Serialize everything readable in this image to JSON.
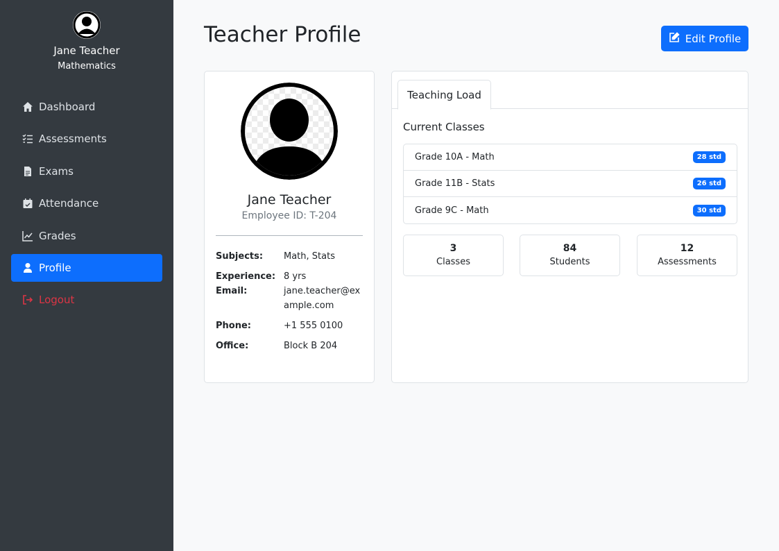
{
  "sidebar": {
    "user_name": "Jane Teacher",
    "department": "Mathematics",
    "nav": [
      {
        "label": "Dashboard",
        "icon": "home-icon"
      },
      {
        "label": "Assessments",
        "icon": "checklist-icon"
      },
      {
        "label": "Exams",
        "icon": "document-icon"
      },
      {
        "label": "Attendance",
        "icon": "calendar-check-icon"
      },
      {
        "label": "Grades",
        "icon": "chart-line-icon"
      },
      {
        "label": "Profile",
        "icon": "user-icon",
        "active": true
      },
      {
        "label": "Logout",
        "icon": "logout-icon"
      }
    ]
  },
  "header": {
    "title": "Teacher Profile",
    "edit_button": "Edit Profile"
  },
  "profile": {
    "name": "Jane Teacher",
    "employee_id": "Employee ID: T-204",
    "fields": [
      {
        "label": "Subjects:",
        "value": "Math, Stats"
      },
      {
        "label": "Experience:",
        "value": "8 yrs"
      },
      {
        "label": "Email:",
        "value": "jane.teacher@example.com"
      },
      {
        "label": "Phone:",
        "value": "+1 555 0100"
      },
      {
        "label": "Office:",
        "value": "Block B 204"
      }
    ]
  },
  "teaching": {
    "tab_label": "Teaching Load",
    "section_title": "Current Classes",
    "classes": [
      {
        "name": "Grade 10A - Math",
        "badge": "28 std"
      },
      {
        "name": "Grade 11B - Stats",
        "badge": "26 std"
      },
      {
        "name": "Grade 9C - Math",
        "badge": "30 std"
      }
    ],
    "stats": [
      {
        "value": "3",
        "label": "Classes"
      },
      {
        "value": "84",
        "label": "Students"
      },
      {
        "value": "12",
        "label": "Assessments"
      }
    ]
  },
  "colors": {
    "sidebar_bg": "#343a40",
    "accent": "#0d6efd",
    "danger": "#dc3545",
    "page_bg": "#f8f9fa"
  }
}
